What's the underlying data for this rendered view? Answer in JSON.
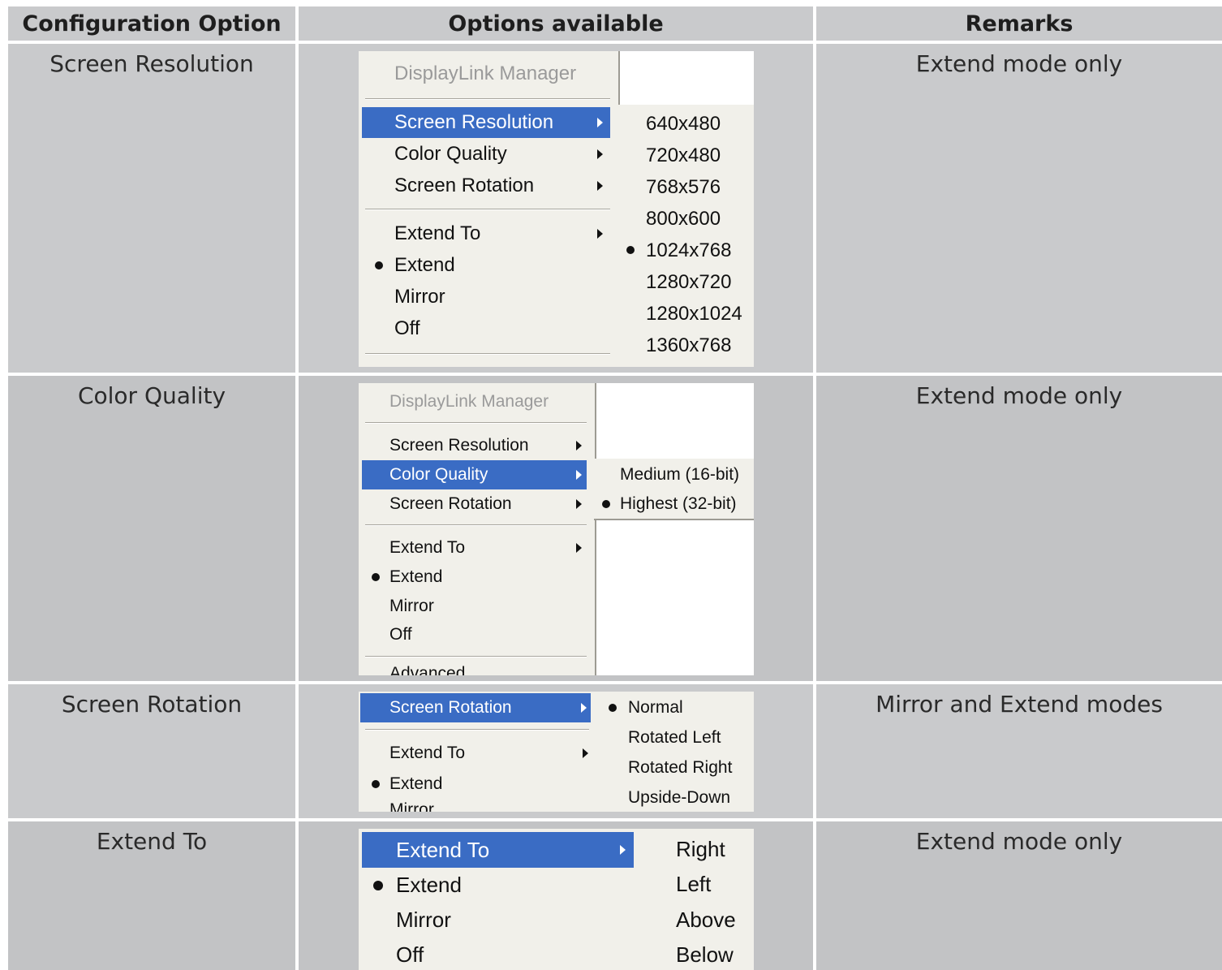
{
  "headers": {
    "option": "Configuration Option",
    "available": "Options available",
    "remarks": "Remarks"
  },
  "rows": [
    {
      "option": "Screen Resolution",
      "remarks": "Extend mode only",
      "menu": {
        "title": "DisplayLink Manager",
        "items": [
          "Screen Resolution",
          "Color Quality",
          "Screen Rotation",
          "Extend To",
          "Extend",
          "Mirror",
          "Off"
        ],
        "selected": "Screen Resolution",
        "checked": "Extend",
        "submenu": [
          "640x480",
          "720x480",
          "768x576",
          "800x600",
          "1024x768",
          "1280x720",
          "1280x1024",
          "1360x768"
        ],
        "submenu_checked": "1024x768"
      }
    },
    {
      "option": "Color Quality",
      "remarks": "Extend mode only",
      "menu": {
        "title": "DisplayLink Manager",
        "items": [
          "Screen Resolution",
          "Color Quality",
          "Screen Rotation",
          "Extend To",
          "Extend",
          "Mirror",
          "Off",
          "Advanced"
        ],
        "selected": "Color Quality",
        "checked": "Extend",
        "submenu": [
          "Medium (16-bit)",
          "Highest (32-bit)"
        ],
        "submenu_checked": "Highest (32-bit)"
      }
    },
    {
      "option": "Screen Rotation",
      "remarks": "Mirror and Extend modes",
      "menu": {
        "items": [
          "Screen Rotation",
          "Extend To",
          "Extend",
          "Mirror"
        ],
        "selected": "Screen Rotation",
        "checked": "Extend",
        "submenu": [
          "Normal",
          "Rotated Left",
          "Rotated Right",
          "Upside-Down"
        ],
        "submenu_checked": "Normal"
      }
    },
    {
      "option": "Extend To",
      "remarks": "Extend mode only",
      "menu": {
        "items": [
          "Extend To",
          "Extend",
          "Mirror",
          "Off"
        ],
        "selected": "Extend To",
        "checked": "Extend",
        "submenu": [
          "Right",
          "Left",
          "Above",
          "Below"
        ]
      }
    }
  ]
}
